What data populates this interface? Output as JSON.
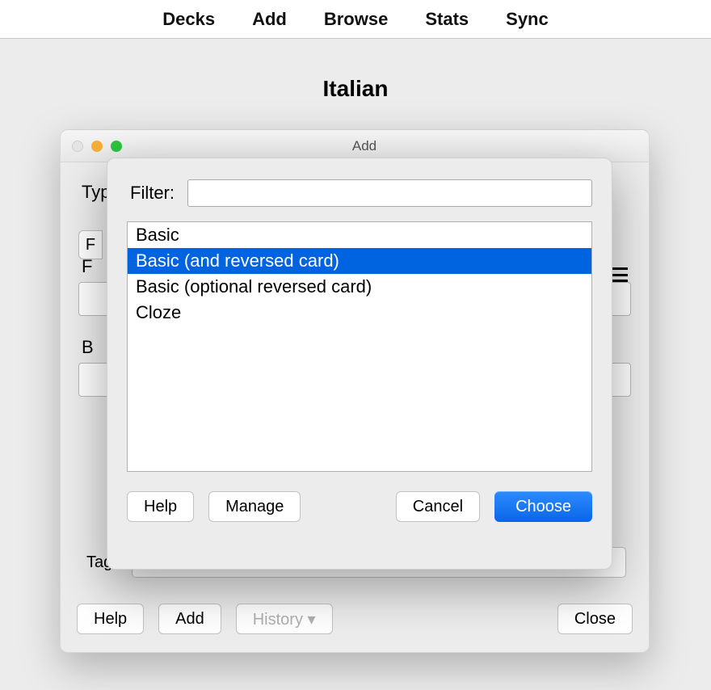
{
  "menubar": {
    "decks": "Decks",
    "add": "Add",
    "browse": "Browse",
    "stats": "Stats",
    "sync": "Sync"
  },
  "deck": {
    "title": "Italian"
  },
  "add_window": {
    "title": "Add",
    "traffic_colors": {
      "close": "#e5e5e5",
      "min": "#f7b035",
      "max": "#2ac43f"
    },
    "type_label_truncated": "Typ",
    "fields_btn_truncated": "F",
    "front_label": "F",
    "back_label": "B",
    "tags_label": "Tags",
    "buttons": {
      "help": "Help",
      "add": "Add",
      "history": "History ▾",
      "close": "Close"
    }
  },
  "chooser": {
    "filter_label": "Filter:",
    "filter_value": "",
    "items": [
      "Basic",
      "Basic (and reversed card)",
      "Basic (optional reversed card)",
      "Cloze"
    ],
    "selected_index": 1,
    "buttons": {
      "help": "Help",
      "manage": "Manage",
      "cancel": "Cancel",
      "choose": "Choose"
    }
  }
}
